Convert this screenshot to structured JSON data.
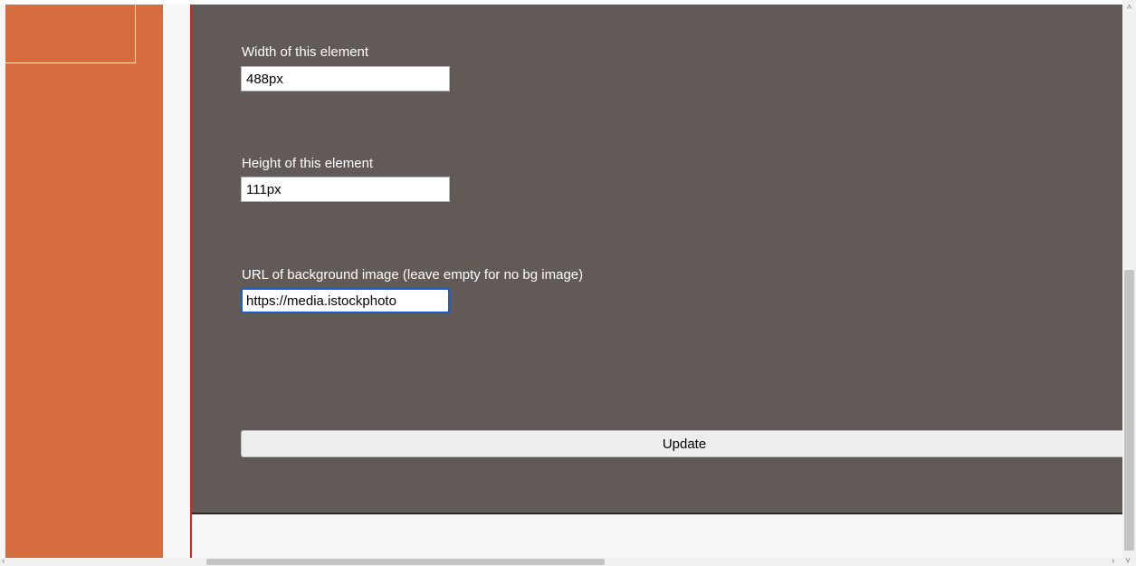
{
  "form": {
    "width_label": "Width of this element",
    "width_value": "488px",
    "height_label": "Height of this element",
    "height_value": "111px",
    "bg_url_label": "URL of background image (leave empty for no bg image)",
    "bg_url_value": "https://media.istockphoto",
    "update_label": "Update"
  },
  "scrollbars": {
    "up_arrow": "˄",
    "down_arrow": "˅",
    "left_arrow": "‹",
    "right_arrow": "›"
  },
  "colors": {
    "orange_sidebar": "#d56d3f",
    "panel_background": "#625a56",
    "divider_red": "#e0241a",
    "focus_ring": "#1a5fd0"
  }
}
